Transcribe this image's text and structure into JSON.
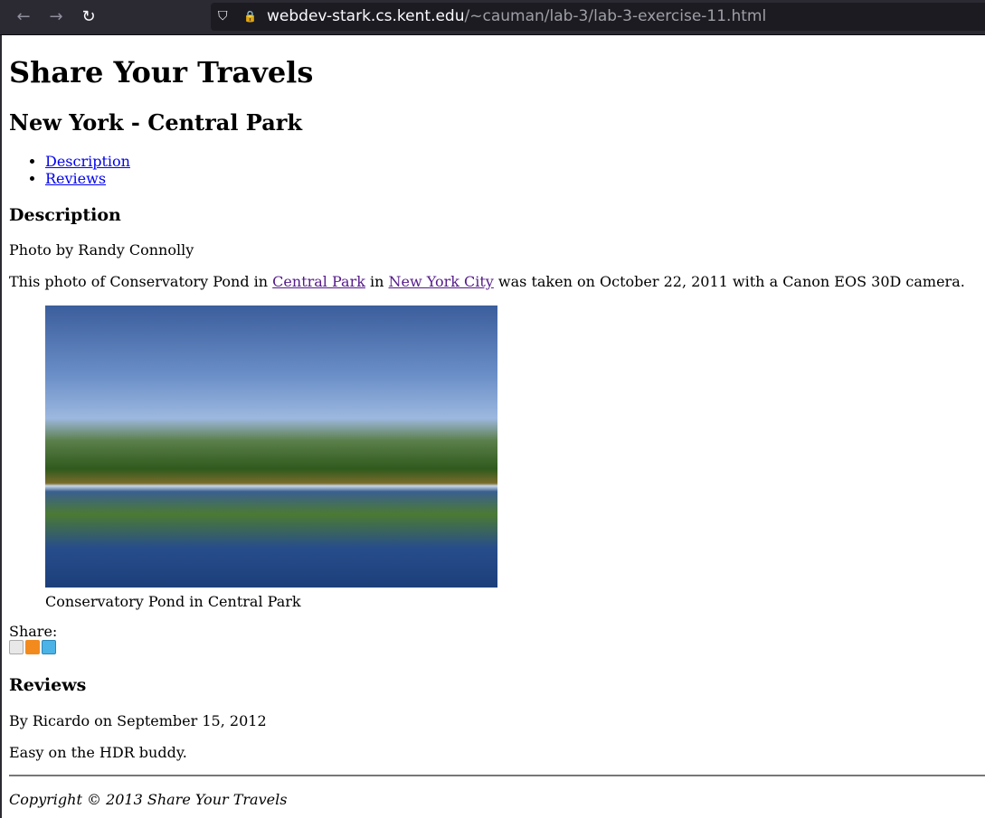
{
  "browser": {
    "url_host": "webdev-stark.cs.kent.edu",
    "url_prefix": "",
    "url_path": "/~cauman/lab-3/lab-3-exercise-11.html",
    "back_icon": "←",
    "forward_icon": "→",
    "reload_icon": "↻",
    "shield_icon": "⛉",
    "lock_icon": "🔒"
  },
  "page": {
    "site_title": "Share Your Travels",
    "photo_title": "New York - Central Park",
    "nav": [
      {
        "label": "Description"
      },
      {
        "label": "Reviews"
      }
    ],
    "description": {
      "heading": "Description",
      "credit": "Photo by Randy Connolly",
      "text_1": "This photo of Conservatory Pond in ",
      "link_1": "Central Park",
      "text_2": " in ",
      "link_2": "New York City",
      "text_3": " was taken on October 22, 2011 with a Canon EOS 30D camera.",
      "figure_caption": "Conservatory Pond in Central Park"
    },
    "share": {
      "label": "Share:",
      "icons": [
        "email-icon",
        "rss-icon",
        "twitter-icon"
      ]
    },
    "reviews": {
      "heading": "Reviews",
      "byline": "By Ricardo on September 15, 2012",
      "text": "Easy on the HDR buddy."
    },
    "footer": "Copyright © 2013 Share Your Travels"
  }
}
